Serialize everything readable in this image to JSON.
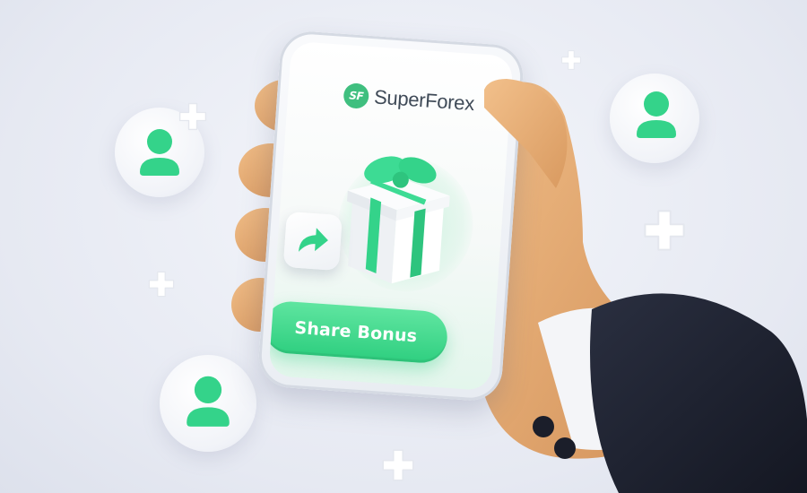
{
  "brand": {
    "logo_mark": "SF",
    "name": "SuperForex",
    "accent": "#3fbf7f"
  },
  "screen": {
    "share_button_label": "Share Bonus",
    "gift_icon": "gift-box-icon",
    "share_icon": "share-arrow-icon"
  },
  "decor": {
    "avatar_icon": "user-avatar-icon",
    "sparkle_icon": "plus-sparkle-icon",
    "bubble_count": 3,
    "sparkle_count": 5
  },
  "colors": {
    "green": "#34d38a",
    "skin": "#e3a66b",
    "sleeve": "#1d2130",
    "cuff": "#f4f5f8"
  }
}
